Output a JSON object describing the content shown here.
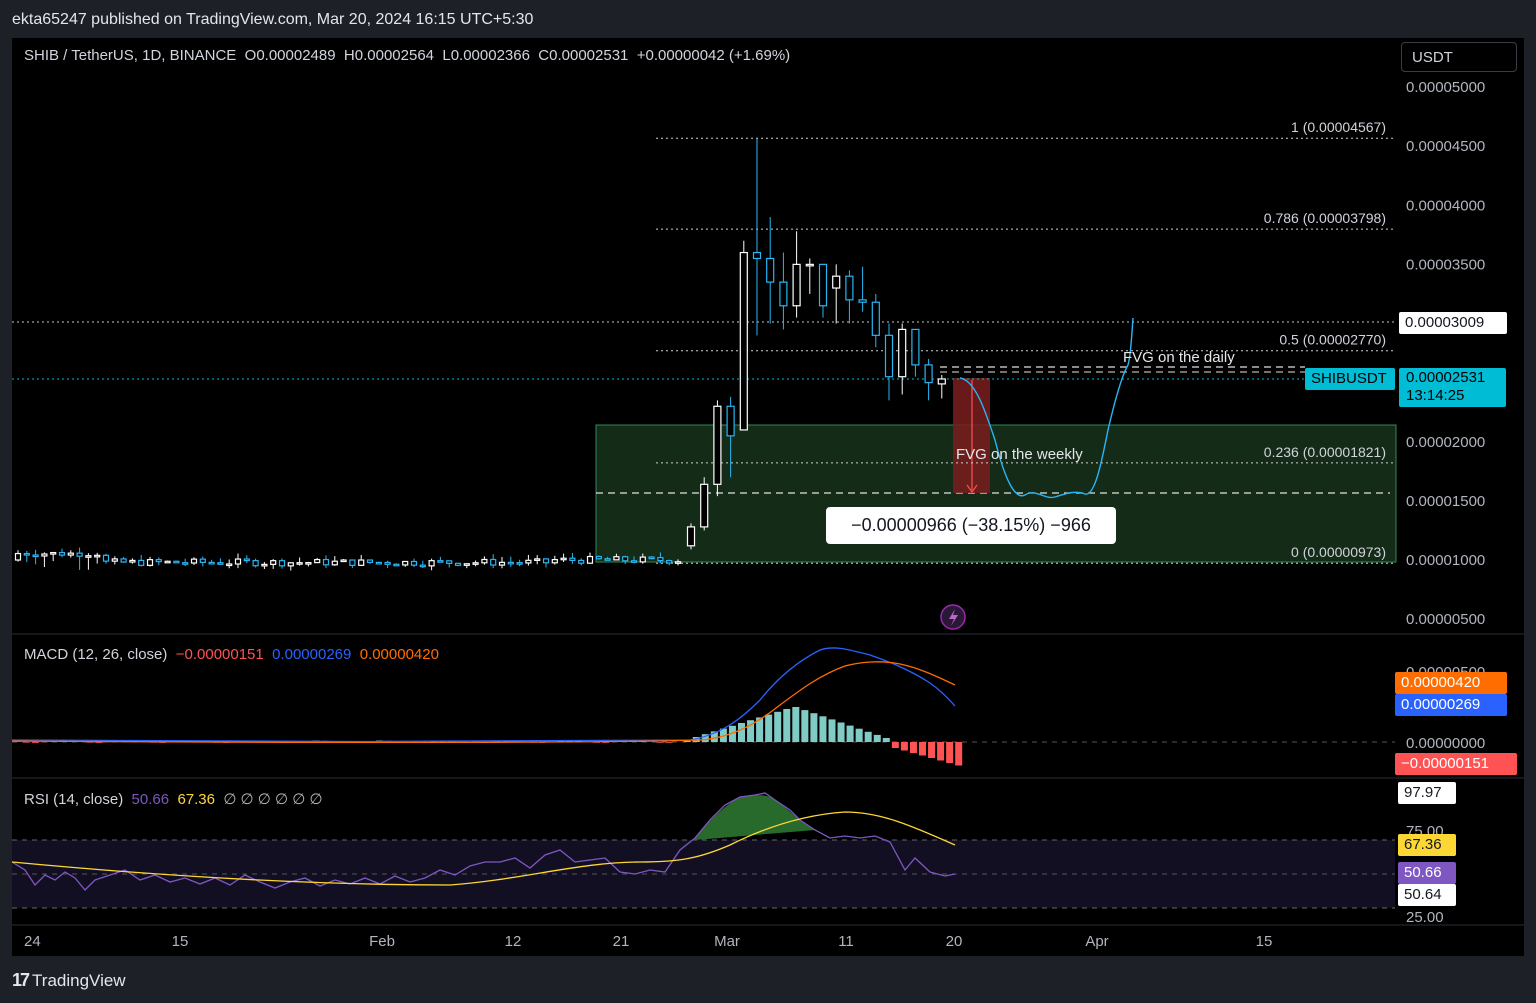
{
  "header": {
    "publish_text": "ekta65247 published on TradingView.com, Mar 20, 2024 16:15 UTC+5:30"
  },
  "legend": {
    "symbol": "SHIB / TetherUS, 1D, BINANCE",
    "o_label": "O",
    "o_value": "0.00002489",
    "h_label": "H",
    "h_value": "0.00002564",
    "l_label": "L",
    "l_value": "0.00002366",
    "c_label": "C",
    "c_value": "0.00002531",
    "change": "+0.00000042 (+1.69%)"
  },
  "currency_button": "USDT",
  "price_axis": {
    "ticks": [
      "0.00005000",
      "0.00004500",
      "0.00004000",
      "0.00003500",
      "0.00002000",
      "0.00001500",
      "0.00001000",
      "0.00000500"
    ],
    "tick_values": [
      5e-05,
      4.5e-05,
      4e-05,
      3.5e-05,
      2e-05,
      1.5e-05,
      1e-05,
      5e-06
    ],
    "crosshair_label": "0.00003009",
    "last_price_label": "0.00002531",
    "countdown": "13:14:25",
    "symbol_tag": "SHIBUSDT"
  },
  "fib_levels": [
    {
      "label": "1 (0.00004567)",
      "value": 4.567e-05
    },
    {
      "label": "0.786 (0.00003798)",
      "value": 3.798e-05
    },
    {
      "label": "0.5 (0.00002770)",
      "value": 2.77e-05
    },
    {
      "label": "0.236 (0.00001821)",
      "value": 1.821e-05
    },
    {
      "label": "0 (0.00000973)",
      "value": 9.73e-06
    }
  ],
  "annotations": {
    "fvg_daily": "FVG on the daily",
    "fvg_weekly": "FVG on the weekly",
    "measure": "−0.00000966 (−38.15%) −966"
  },
  "macd": {
    "title": "MACD (12, 26, close)",
    "hist_value": "−0.00000151",
    "macd_value": "0.00000269",
    "signal_value": "0.00000420",
    "axis_ticks": [
      "0.00000500",
      "0.00000000"
    ],
    "colors": {
      "hist_neg": "#ff5252",
      "macd": "#2962ff",
      "signal": "#ff6d00",
      "hist_pos": "#26a69a"
    }
  },
  "rsi": {
    "title": "RSI (14, close)",
    "rsi_value": "50.66",
    "ma_value": "67.36",
    "empty_values": "∅ ∅ ∅ ∅ ∅ ∅",
    "axis_ticks": [
      "75.00",
      "25.00"
    ],
    "badges": [
      "97.97",
      "67.36",
      "50.66",
      "50.64"
    ],
    "colors": {
      "rsi": "#7e57c2",
      "ma": "#fdd835"
    }
  },
  "time_axis": {
    "labels": [
      "24",
      "15",
      "Feb",
      "12",
      "21",
      "Mar",
      "11",
      "20",
      "Apr",
      "15"
    ]
  },
  "footer": {
    "brand": "TradingView"
  },
  "chart_data": {
    "type": "candlestick",
    "title": "SHIB / TetherUS, 1D, BINANCE",
    "ylim": [
      2.5e-06,
      5.3e-06
    ],
    "candles_recent": [
      {
        "o": 1.12e-05,
        "h": 1.31e-05,
        "l": 1.09e-05,
        "c": 1.28e-05
      },
      {
        "o": 1.28e-05,
        "h": 1.7e-05,
        "l": 1.25e-05,
        "c": 1.64e-05
      },
      {
        "o": 1.64e-05,
        "h": 2.35e-05,
        "l": 1.54e-05,
        "c": 2.3e-05
      },
      {
        "o": 2.3e-05,
        "h": 2.38e-05,
        "l": 1.7e-05,
        "c": 2.05e-05
      },
      {
        "o": 2.1e-05,
        "h": 3.7e-05,
        "l": 2.1e-05,
        "c": 3.6e-05
      },
      {
        "o": 3.6e-05,
        "h": 4.567e-05,
        "l": 2.9e-05,
        "c": 3.55e-05
      },
      {
        "o": 3.55e-05,
        "h": 3.9e-05,
        "l": 3e-05,
        "c": 3.35e-05
      },
      {
        "o": 3.35e-05,
        "h": 3.6e-05,
        "l": 2.95e-05,
        "c": 3.15e-05
      },
      {
        "o": 3.15e-05,
        "h": 3.78e-05,
        "l": 3.05e-05,
        "c": 3.5e-05
      },
      {
        "o": 3.5e-05,
        "h": 3.55e-05,
        "l": 3.25e-05,
        "c": 3.5e-05
      },
      {
        "o": 3.5e-05,
        "h": 3.5e-05,
        "l": 3.05e-05,
        "c": 3.15e-05
      },
      {
        "o": 3.3e-05,
        "h": 3.5e-05,
        "l": 3e-05,
        "c": 3.4e-05
      },
      {
        "o": 3.4e-05,
        "h": 3.45e-05,
        "l": 3e-05,
        "c": 3.2e-05
      },
      {
        "o": 3.2e-05,
        "h": 3.48e-05,
        "l": 3.1e-05,
        "c": 3.18e-05
      },
      {
        "o": 3.18e-05,
        "h": 3.25e-05,
        "l": 2.8e-05,
        "c": 2.9e-05
      },
      {
        "o": 2.9e-05,
        "h": 3e-05,
        "l": 2.35e-05,
        "c": 2.55e-05
      },
      {
        "o": 2.55e-05,
        "h": 3e-05,
        "l": 2.4e-05,
        "c": 2.95e-05
      },
      {
        "o": 2.95e-05,
        "h": 2.95e-05,
        "l": 2.55e-05,
        "c": 2.65e-05
      },
      {
        "o": 2.65e-05,
        "h": 2.7e-05,
        "l": 2.35e-05,
        "c": 2.5e-05
      },
      {
        "o": 2.489e-05,
        "h": 2.564e-05,
        "l": 2.366e-05,
        "c": 2.531e-05
      }
    ]
  }
}
